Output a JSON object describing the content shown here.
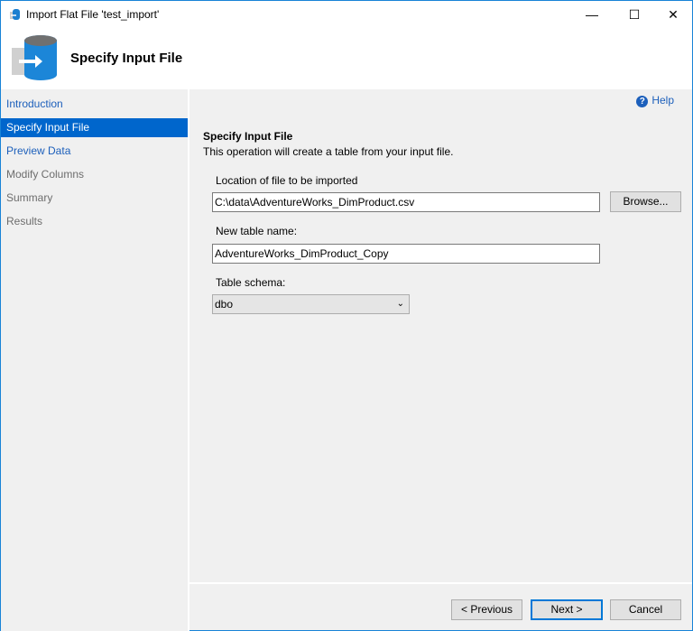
{
  "window": {
    "title": "Import Flat File 'test_import'",
    "minimize": "—",
    "maximize": "☐",
    "close": "✕"
  },
  "header": {
    "title": "Specify Input File"
  },
  "sidebar": {
    "items": [
      {
        "label": "Introduction",
        "state": "link"
      },
      {
        "label": "Specify Input File",
        "state": "selected"
      },
      {
        "label": "Preview Data",
        "state": "link"
      },
      {
        "label": "Modify Columns",
        "state": "disabled"
      },
      {
        "label": "Summary",
        "state": "disabled"
      },
      {
        "label": "Results",
        "state": "disabled"
      }
    ]
  },
  "main": {
    "help": "Help",
    "section_title": "Specify Input File",
    "description": "This operation will create a table from your input file.",
    "location_label": "Location of file to be imported",
    "location_value": "C:\\data\\AdventureWorks_DimProduct.csv",
    "browse": "Browse...",
    "table_name_label": "New table name:",
    "table_name_value": "AdventureWorks_DimProduct_Copy",
    "schema_label": "Table schema:",
    "schema_value": "dbo"
  },
  "footer": {
    "previous": "< Previous",
    "next": "Next >",
    "cancel": "Cancel"
  }
}
